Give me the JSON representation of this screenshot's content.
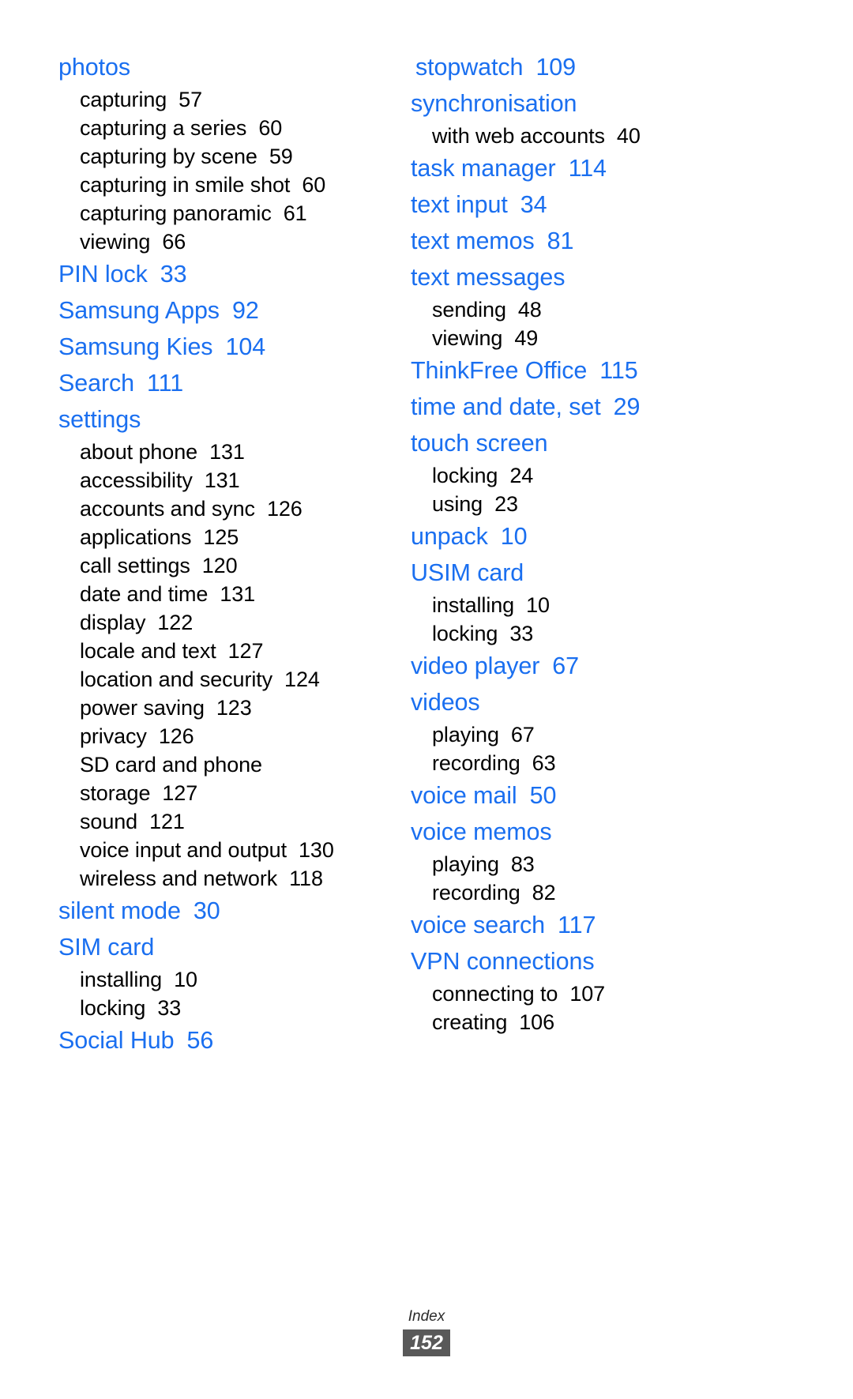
{
  "colors": {
    "heading": "#1a6ff0",
    "body": "#000000",
    "footer_badge_bg": "#595959",
    "footer_badge_text": "#ffffff"
  },
  "footer": {
    "label": "Index",
    "page_number": "152"
  },
  "left_column": [
    {
      "heading": "photos",
      "heading_page": "",
      "subs": [
        {
          "label": "capturing",
          "page": "57"
        },
        {
          "label": "capturing a series",
          "page": "60"
        },
        {
          "label": "capturing by scene",
          "page": "59"
        },
        {
          "label": "capturing in smile shot",
          "page": "60"
        },
        {
          "label": "capturing panoramic",
          "page": "61"
        },
        {
          "label": "viewing",
          "page": "66"
        }
      ]
    },
    {
      "heading": "PIN lock",
      "heading_page": "33",
      "subs": []
    },
    {
      "heading": "Samsung Apps",
      "heading_page": "92",
      "subs": []
    },
    {
      "heading": "Samsung Kies",
      "heading_page": "104",
      "subs": []
    },
    {
      "heading": "Search",
      "heading_page": "111",
      "subs": []
    },
    {
      "heading": "settings",
      "heading_page": "",
      "subs": [
        {
          "label": "about phone",
          "page": "131"
        },
        {
          "label": "accessibility",
          "page": "131"
        },
        {
          "label": "accounts and sync",
          "page": "126"
        },
        {
          "label": "applications",
          "page": "125"
        },
        {
          "label": "call settings",
          "page": "120"
        },
        {
          "label": "date and time",
          "page": "131"
        },
        {
          "label": "display",
          "page": "122"
        },
        {
          "label": "locale and text",
          "page": "127"
        },
        {
          "label": "location and security",
          "page": "124"
        },
        {
          "label": "power saving",
          "page": "123"
        },
        {
          "label": "privacy",
          "page": "126"
        },
        {
          "label": "SD card and phone storage",
          "page": "127",
          "wrap": true
        },
        {
          "label": "sound",
          "page": "121"
        },
        {
          "label": "voice input and output",
          "page": "130"
        },
        {
          "label": "wireless and network",
          "page": "118"
        }
      ]
    },
    {
      "heading": "silent mode",
      "heading_page": "30",
      "subs": []
    },
    {
      "heading": "SIM card",
      "heading_page": "",
      "subs": [
        {
          "label": "installing",
          "page": "10"
        },
        {
          "label": "locking",
          "page": "33"
        }
      ]
    },
    {
      "heading": "Social Hub",
      "heading_page": "56",
      "subs": []
    }
  ],
  "right_column": [
    {
      "heading": "stopwatch",
      "heading_page": "109",
      "subs": [],
      "indent": true
    },
    {
      "heading": "synchronisation",
      "heading_page": "",
      "subs": [
        {
          "label": "with web accounts",
          "page": "40"
        }
      ]
    },
    {
      "heading": "task manager",
      "heading_page": "114",
      "subs": []
    },
    {
      "heading": "text input",
      "heading_page": "34",
      "subs": []
    },
    {
      "heading": "text memos",
      "heading_page": "81",
      "subs": []
    },
    {
      "heading": "text messages",
      "heading_page": "",
      "subs": [
        {
          "label": "sending",
          "page": "48"
        },
        {
          "label": "viewing",
          "page": "49"
        }
      ]
    },
    {
      "heading": "ThinkFree Office",
      "heading_page": "115",
      "subs": []
    },
    {
      "heading": "time and date, set",
      "heading_page": "29",
      "subs": []
    },
    {
      "heading": "touch screen",
      "heading_page": "",
      "subs": [
        {
          "label": "locking",
          "page": "24"
        },
        {
          "label": "using",
          "page": "23"
        }
      ]
    },
    {
      "heading": "unpack",
      "heading_page": "10",
      "subs": []
    },
    {
      "heading": "USIM card",
      "heading_page": "",
      "subs": [
        {
          "label": "installing",
          "page": "10"
        },
        {
          "label": "locking",
          "page": "33"
        }
      ]
    },
    {
      "heading": "video player",
      "heading_page": "67",
      "subs": []
    },
    {
      "heading": "videos",
      "heading_page": "",
      "subs": [
        {
          "label": "playing",
          "page": "67"
        },
        {
          "label": "recording",
          "page": "63"
        }
      ]
    },
    {
      "heading": "voice mail",
      "heading_page": "50",
      "subs": []
    },
    {
      "heading": "voice memos",
      "heading_page": "",
      "subs": [
        {
          "label": "playing",
          "page": "83"
        },
        {
          "label": "recording",
          "page": "82"
        }
      ]
    },
    {
      "heading": "voice search",
      "heading_page": "117",
      "subs": []
    },
    {
      "heading": "VPN connections",
      "heading_page": "",
      "subs": [
        {
          "label": "connecting to",
          "page": "107"
        },
        {
          "label": "creating",
          "page": "106"
        }
      ]
    }
  ]
}
